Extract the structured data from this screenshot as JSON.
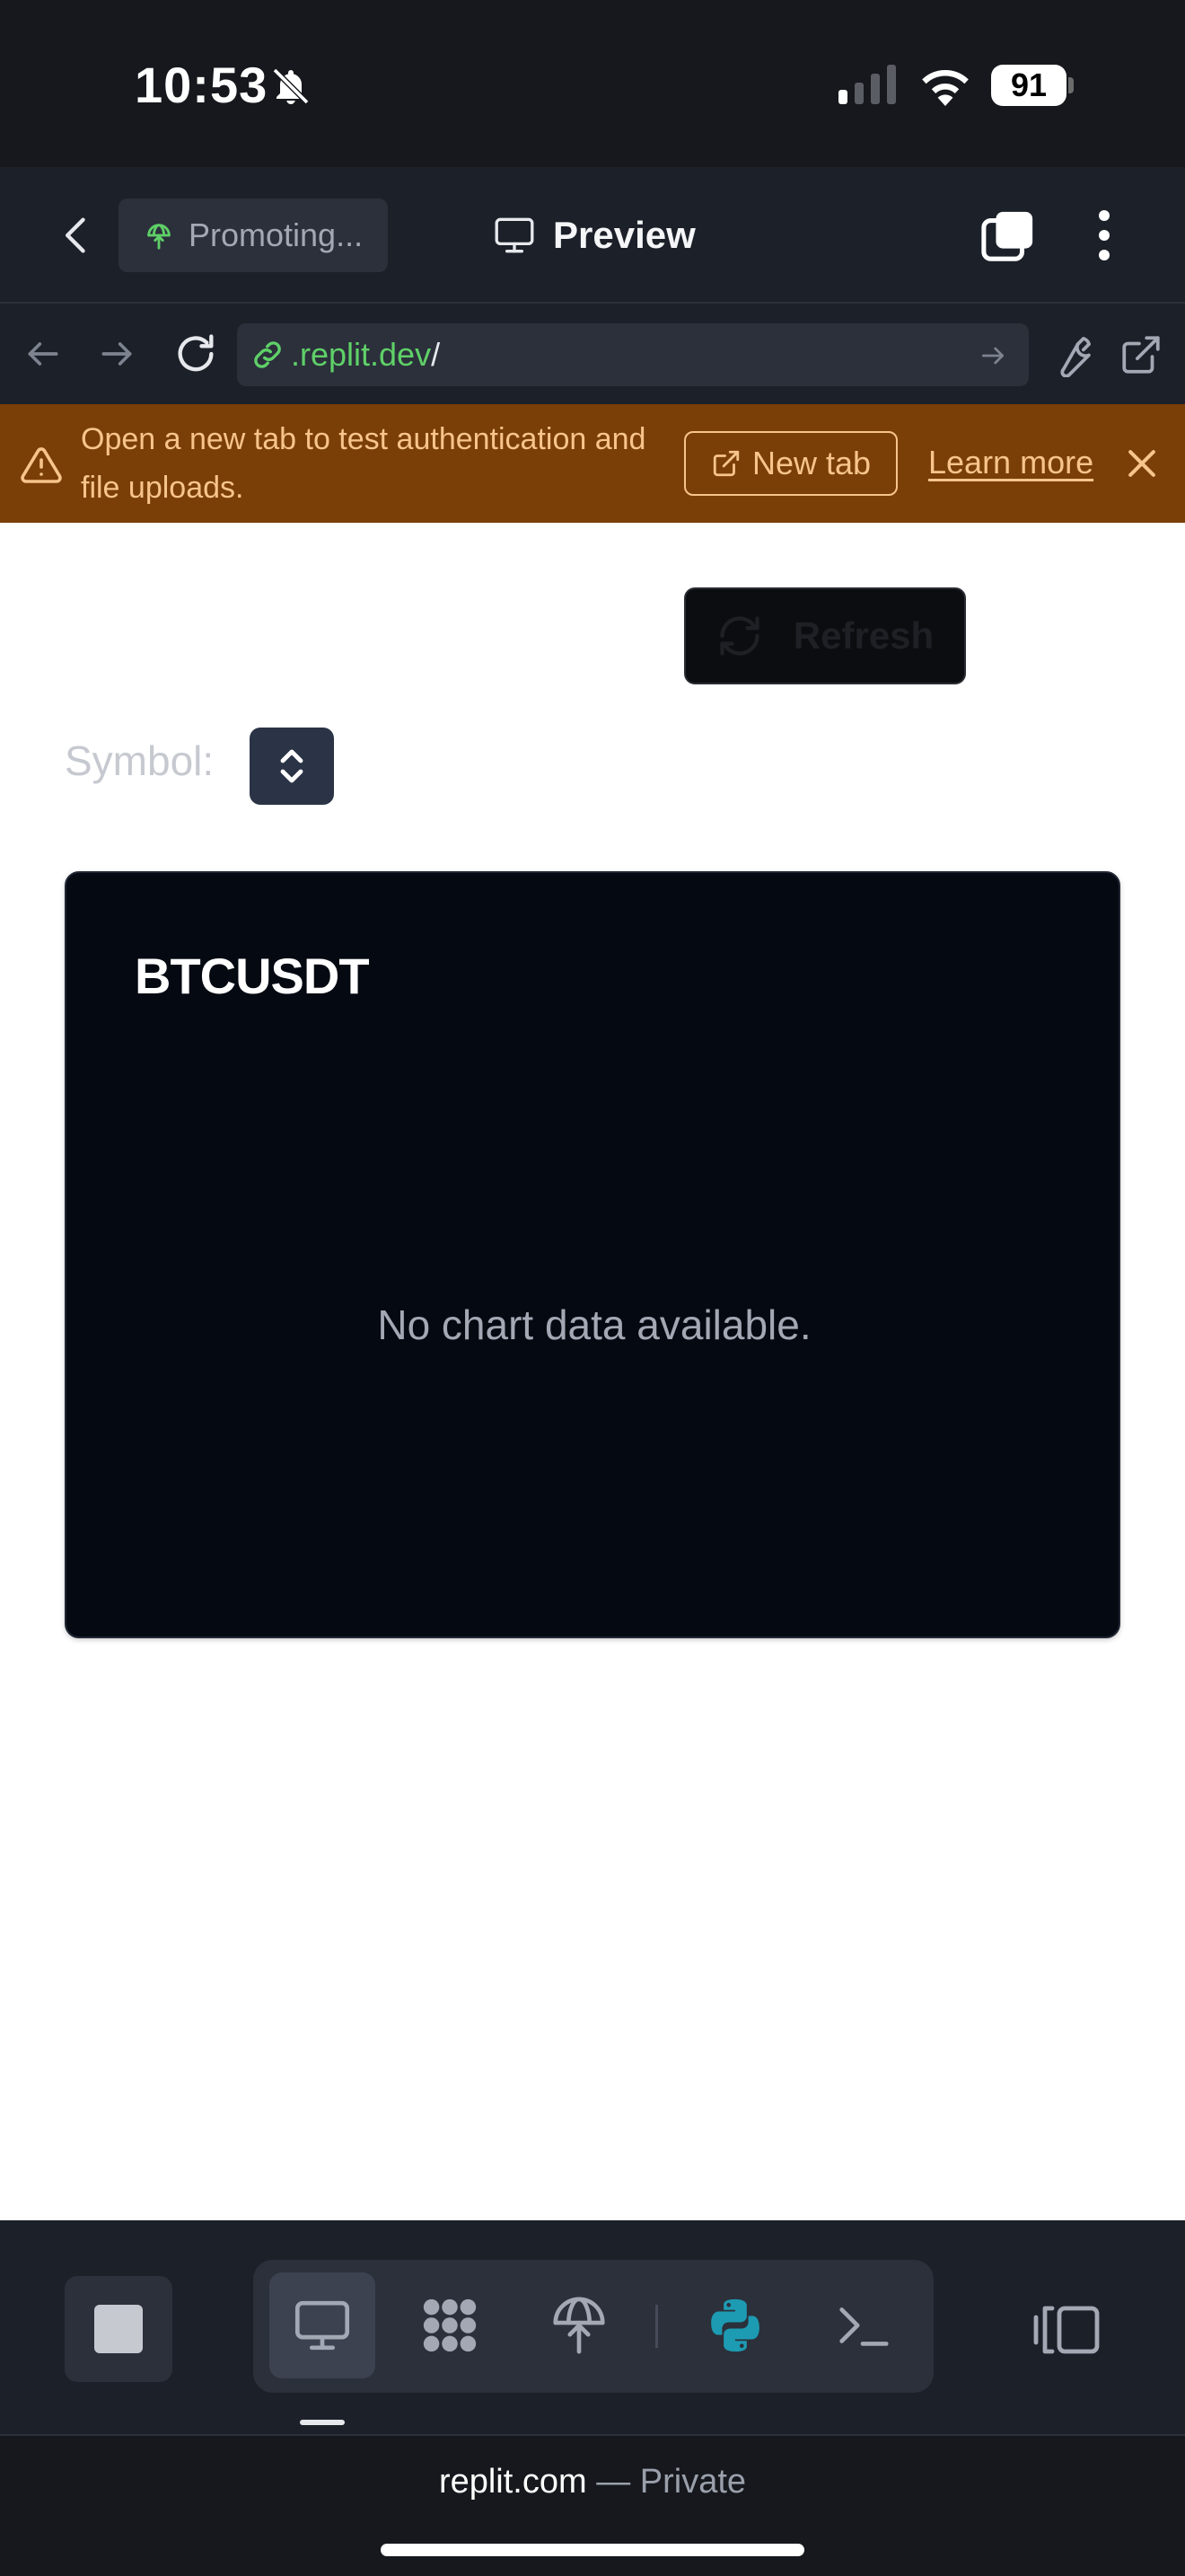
{
  "status_bar": {
    "time": "10:53",
    "battery_level": "91",
    "icons": [
      "bell-off-icon",
      "signal-icon",
      "wifi-icon",
      "battery-icon"
    ]
  },
  "app_header": {
    "project_label": "Promoting...",
    "title": "Preview",
    "icons": [
      "back-icon",
      "project-icon",
      "monitor-icon",
      "tabs-icon",
      "kebab-menu-icon"
    ]
  },
  "url_bar": {
    "host": ".replit.dev",
    "path": "/",
    "icons": [
      "nav-back-icon",
      "nav-forward-icon",
      "reload-icon",
      "link-icon",
      "url-go-icon",
      "wrench-icon",
      "open-external-icon"
    ]
  },
  "banner": {
    "message": "Open a new tab to test authentication and file uploads.",
    "new_tab_label": "New tab",
    "learn_more_label": "Learn more",
    "colors": {
      "background": "#7a3f07",
      "text": "#f7c48c"
    }
  },
  "content": {
    "refresh_label": "Refresh",
    "symbol_label": "Symbol:",
    "chart": {
      "title": "BTCUSDT",
      "empty_message": "No chart data available."
    }
  },
  "toolbar": {
    "tools": [
      {
        "name": "preview-tool",
        "icon": "monitor-icon",
        "active": true
      },
      {
        "name": "agent-tool",
        "icon": "blob-grid-icon",
        "active": false
      },
      {
        "name": "deploy-tool",
        "icon": "deploy-icon",
        "active": false
      },
      {
        "name": "python-tool",
        "icon": "python-icon",
        "active": false
      },
      {
        "name": "shell-tool",
        "icon": "terminal-icon",
        "active": false
      }
    ],
    "accent_color": "#1d9bb3"
  },
  "footer": {
    "domain": "replit.com",
    "separator": "—",
    "privacy": "Private"
  }
}
